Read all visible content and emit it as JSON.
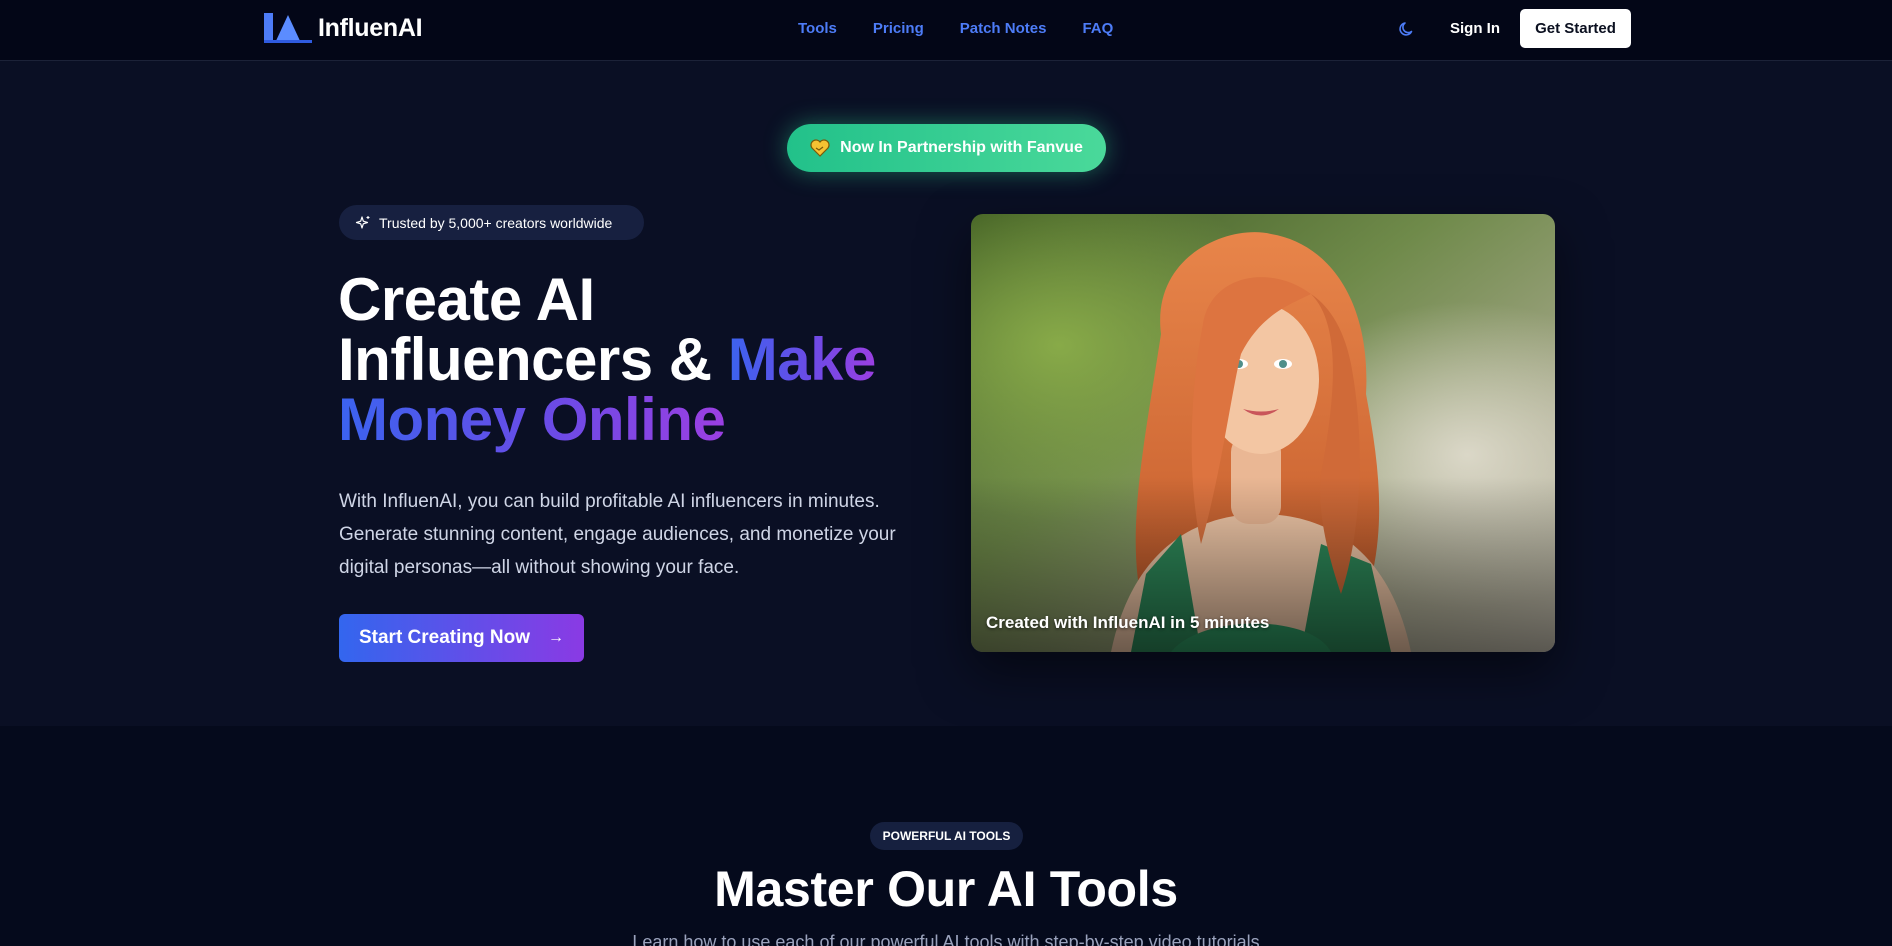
{
  "brand": {
    "name": "InfluenAI"
  },
  "nav": {
    "links": [
      "Tools",
      "Pricing",
      "Patch Notes",
      "FAQ"
    ],
    "sign_in": "Sign In",
    "get_started": "Get Started",
    "theme_icon": "moon-icon"
  },
  "hero": {
    "partner_pill": "Now In Partnership with Fanvue",
    "trusted_badge": "Trusted by 5,000+ creators worldwide",
    "headline_line1": "Create AI",
    "headline_line2_plain": "Influencers & ",
    "headline_line2_grad": "Make",
    "headline_line3_grad": "Money Online",
    "lead": "With InfluenAI, you can build profitable AI influencers in minutes. Generate stunning content, engage audiences, and monetize your digital personas—all without showing your face.",
    "cta": "Start Creating Now",
    "image_caption": "Created with InfluenAI in 5 minutes"
  },
  "tools": {
    "badge": "POWERFUL AI TOOLS",
    "title": "Master Our AI Tools",
    "subtitle": "Learn how to use each of our powerful AI tools with step-by-step video tutorials"
  },
  "colors": {
    "accent_blue": "#3b63ef",
    "accent_purple": "#9b3fe2",
    "partner_green": "#22c18a",
    "nav_link": "#4d7cf7"
  }
}
